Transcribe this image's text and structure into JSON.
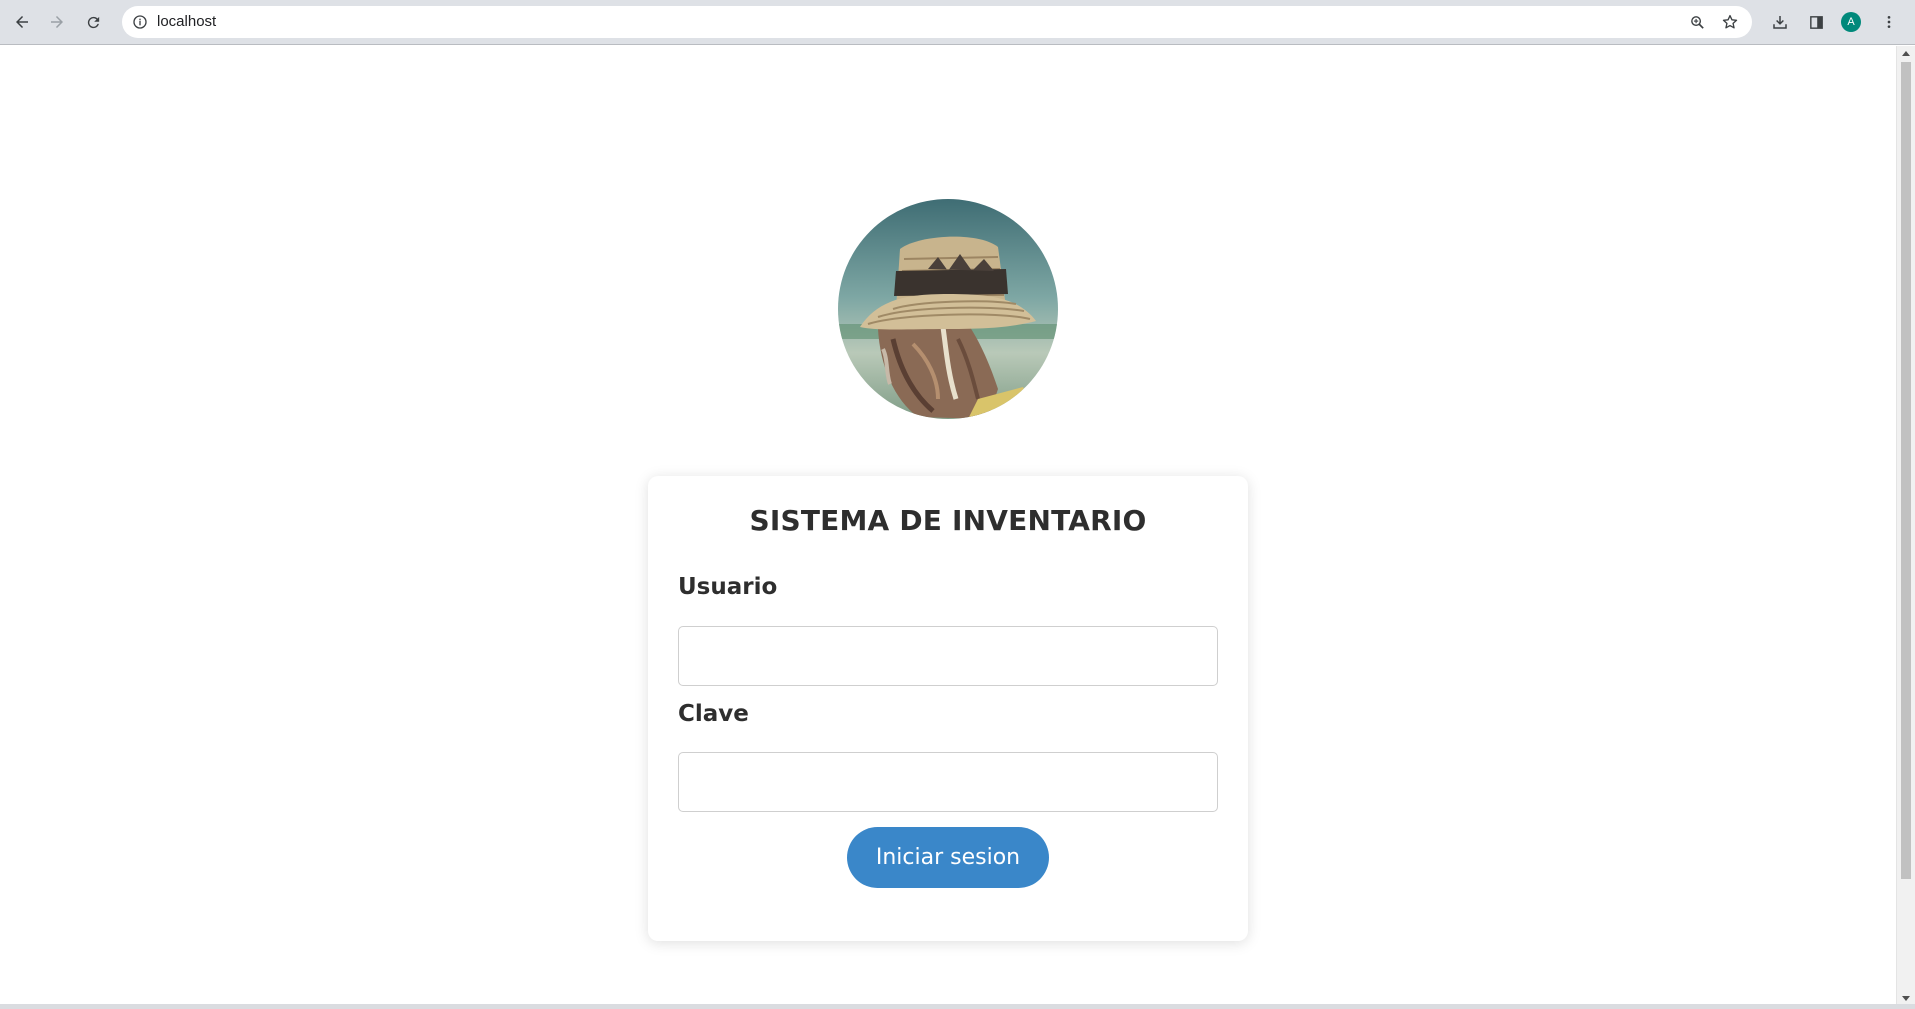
{
  "browser": {
    "url": "localhost",
    "profile_initial": "A",
    "icons": {
      "back": "arrow-back-icon",
      "forward": "arrow-forward-icon",
      "reload": "reload-icon",
      "site_info": "info-icon",
      "zoom": "zoom-icon",
      "bookmark": "star-icon",
      "downloads": "download-icon",
      "side_panel": "side-panel-icon",
      "menu": "kebab-menu-icon"
    }
  },
  "login": {
    "title": "SISTEMA DE INVENTARIO",
    "user_label": "Usuario",
    "user_value": "",
    "password_label": "Clave",
    "password_value": "",
    "submit_label": "Iniciar sesion"
  },
  "colors": {
    "button": "#3a87c9",
    "text": "#2e2e2e",
    "avatar": "#00897b"
  }
}
